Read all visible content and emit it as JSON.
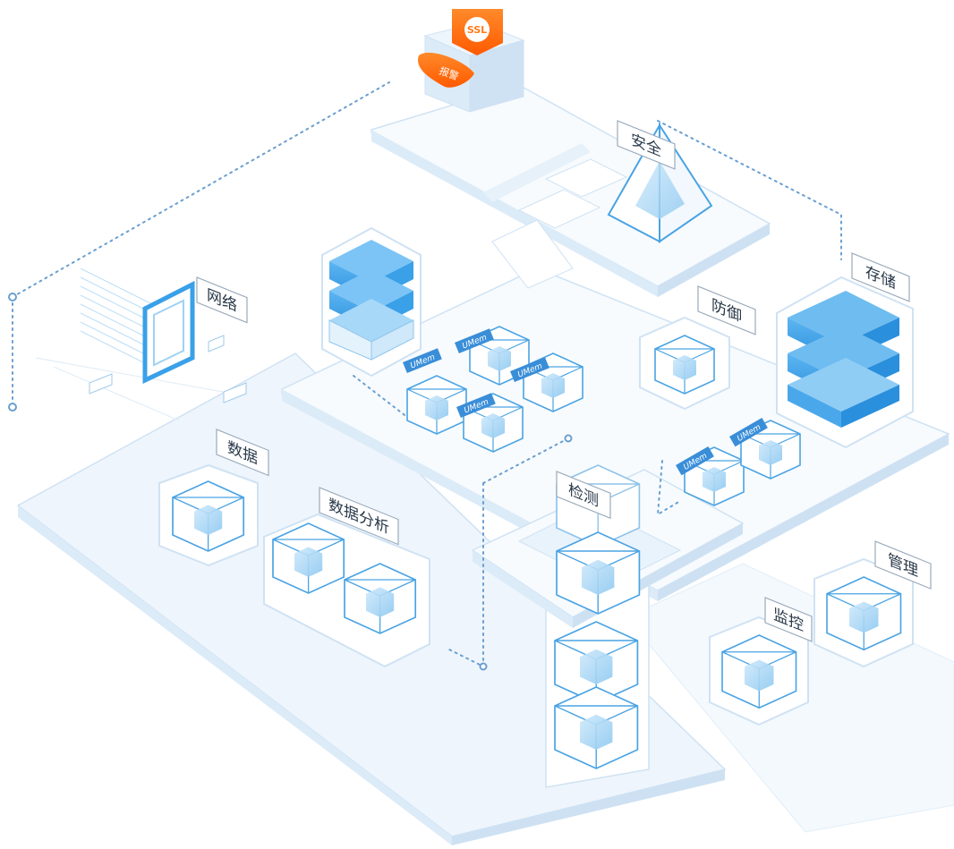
{
  "labels": {
    "security": "安全",
    "storage": "存储",
    "network": "网络",
    "defense": "防御",
    "data": "数据",
    "data_analysis": "数据分析",
    "detection": "检测",
    "monitoring": "监控",
    "management": "管理"
  },
  "tags": {
    "uimem": "UMem",
    "ssl": "SSL",
    "alarm": "报警"
  },
  "colors": {
    "platform_top": "#f7fbfe",
    "platform_side": "#dcebf8",
    "line": "#bcd8f0",
    "accent_blue": "#3aa0e8",
    "deep_blue": "#1e88d6",
    "orange": "#ff6a00",
    "dotted": "#6a9fd0"
  },
  "icons": [
    "ssl-badge-icon",
    "pyramid-icon",
    "server-stack-icon",
    "cube-icon",
    "network-panel-icon"
  ]
}
